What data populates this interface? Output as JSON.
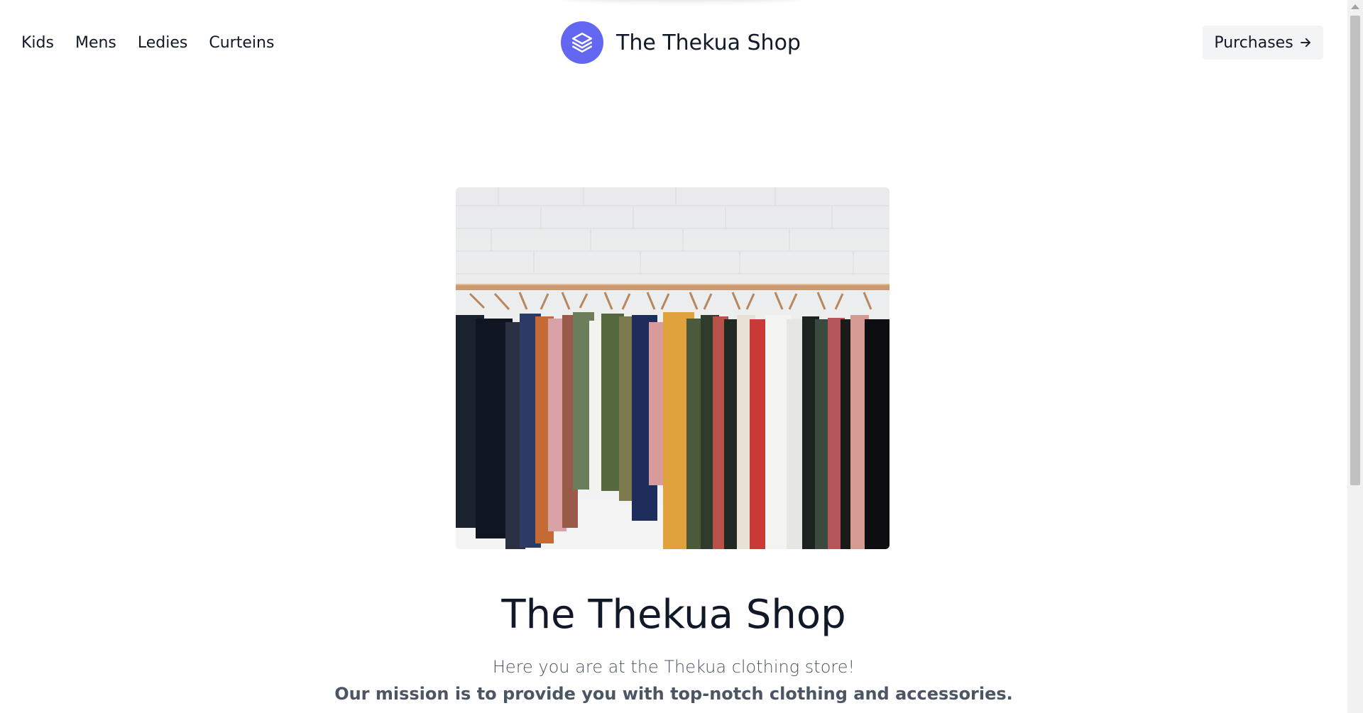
{
  "header": {
    "nav": [
      {
        "label": "Kids"
      },
      {
        "label": "Mens"
      },
      {
        "label": "Ledies"
      },
      {
        "label": "Curteins"
      }
    ],
    "brand_name": "The Thekua Shop",
    "purchases_label": "Purchases",
    "brand_color": "#6366f1"
  },
  "hero": {
    "image_alt": "clothes rack photo",
    "title": "The Thekua Shop",
    "subtitle": "Here you are at the Thekua clothing store!",
    "mission": "Our mission is to provide you with top-notch clothing and accessories."
  },
  "icons": {
    "logo": "layers-icon",
    "purchases": "arrow-right-icon"
  }
}
